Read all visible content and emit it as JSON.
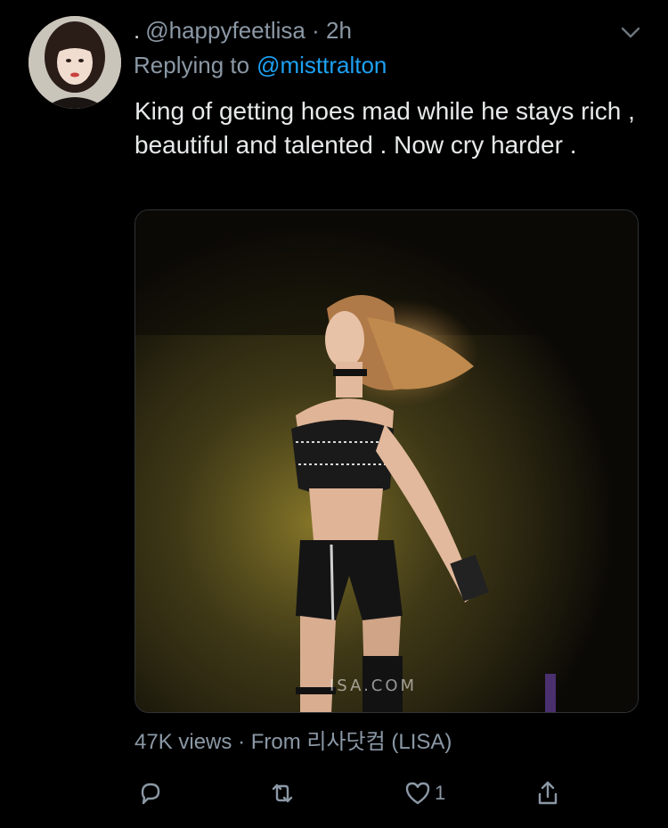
{
  "tweet": {
    "display_name": ".",
    "handle": "@happyfeetlisa",
    "separator": "·",
    "time": "2h",
    "replying_prefix": "Replying to",
    "replying_mention": "@misttralton",
    "text": "King of getting hoes mad while he stays rich , beautiful and talented . Now cry harder .",
    "media_watermark": "ISA.COM",
    "views": "47K views",
    "source_separator": "·",
    "source": "From 리사닷컴 (LISA)",
    "like_count": "1"
  },
  "icons": {
    "avatar": "profile-photo",
    "menu": "chevron-down-icon",
    "reply": "reply-bubble-icon",
    "retweet": "retweet-icon",
    "like": "heart-icon",
    "share": "share-icon"
  },
  "colors": {
    "background": "#000000",
    "text_primary": "#e7e9ea",
    "text_secondary": "#8b98a5",
    "link": "#1da1f2"
  }
}
